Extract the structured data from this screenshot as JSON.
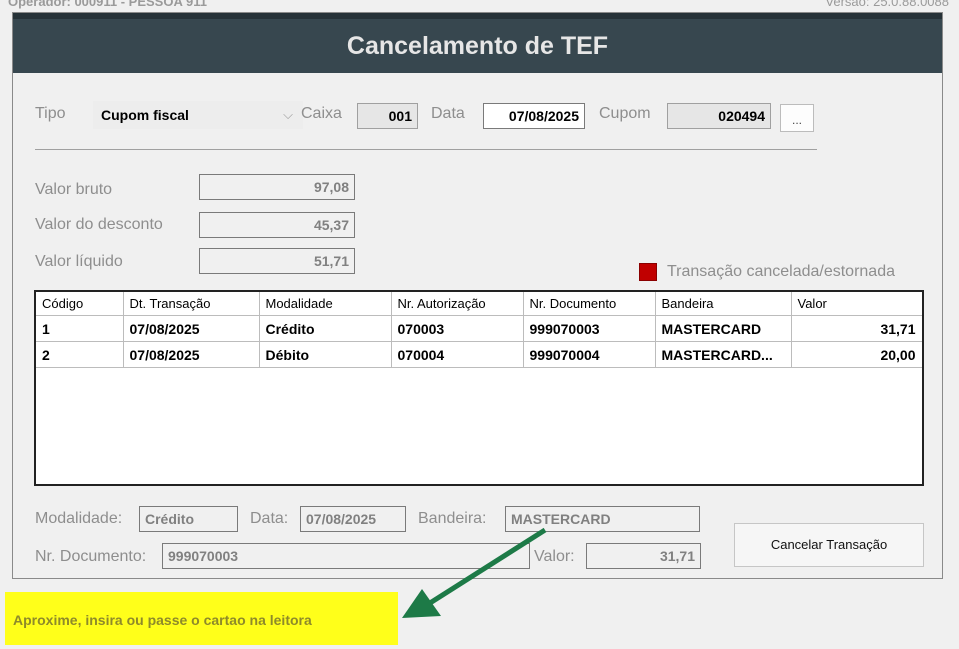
{
  "header": {
    "operator": "Operador: 000911 - PESSOA 911",
    "version": "Versão: 25.0.88.0088"
  },
  "dialog": {
    "title": "Cancelamento de TEF"
  },
  "filters": {
    "tipo_label": "Tipo",
    "tipo_value": "Cupom fiscal",
    "caixa_label": "Caixa",
    "caixa_value": "001",
    "data_label": "Data",
    "data_value": "07/08/2025",
    "cupom_label": "Cupom",
    "cupom_value": "020494",
    "browse_label": "..."
  },
  "totals": {
    "bruto_label": "Valor bruto",
    "bruto_value": "97,08",
    "desconto_label": "Valor do desconto",
    "desconto_value": "45,37",
    "liquido_label": "Valor líquido",
    "liquido_value": "51,71"
  },
  "legend": {
    "label": "Transação cancelada/estornada",
    "color": "#c00000"
  },
  "grid": {
    "columns": [
      "Código",
      "Dt. Transação",
      "Modalidade",
      "Nr. Autorização",
      "Nr. Documento",
      "Bandeira",
      "Valor"
    ],
    "rows": [
      [
        "1",
        "07/08/2025",
        "Crédito",
        "070003",
        "999070003",
        "MASTERCARD",
        "31,71"
      ],
      [
        "2",
        "07/08/2025",
        "Débito",
        "070004",
        "999070004",
        "MASTERCARD...",
        "20,00"
      ]
    ]
  },
  "detail": {
    "modalidade_label": "Modalidade:",
    "modalidade_value": "Crédito",
    "data_label": "Data:",
    "data_value": "07/08/2025",
    "bandeira_label": "Bandeira:",
    "bandeira_value": "MASTERCARD",
    "documento_label": "Nr. Documento:",
    "documento_value": "999070003",
    "valor_label": "Valor:",
    "valor_value": "31,71"
  },
  "actions": {
    "cancel_label": "Cancelar Transação"
  },
  "status": {
    "message": "Aproxime, insira ou passe o cartao na leitora"
  }
}
